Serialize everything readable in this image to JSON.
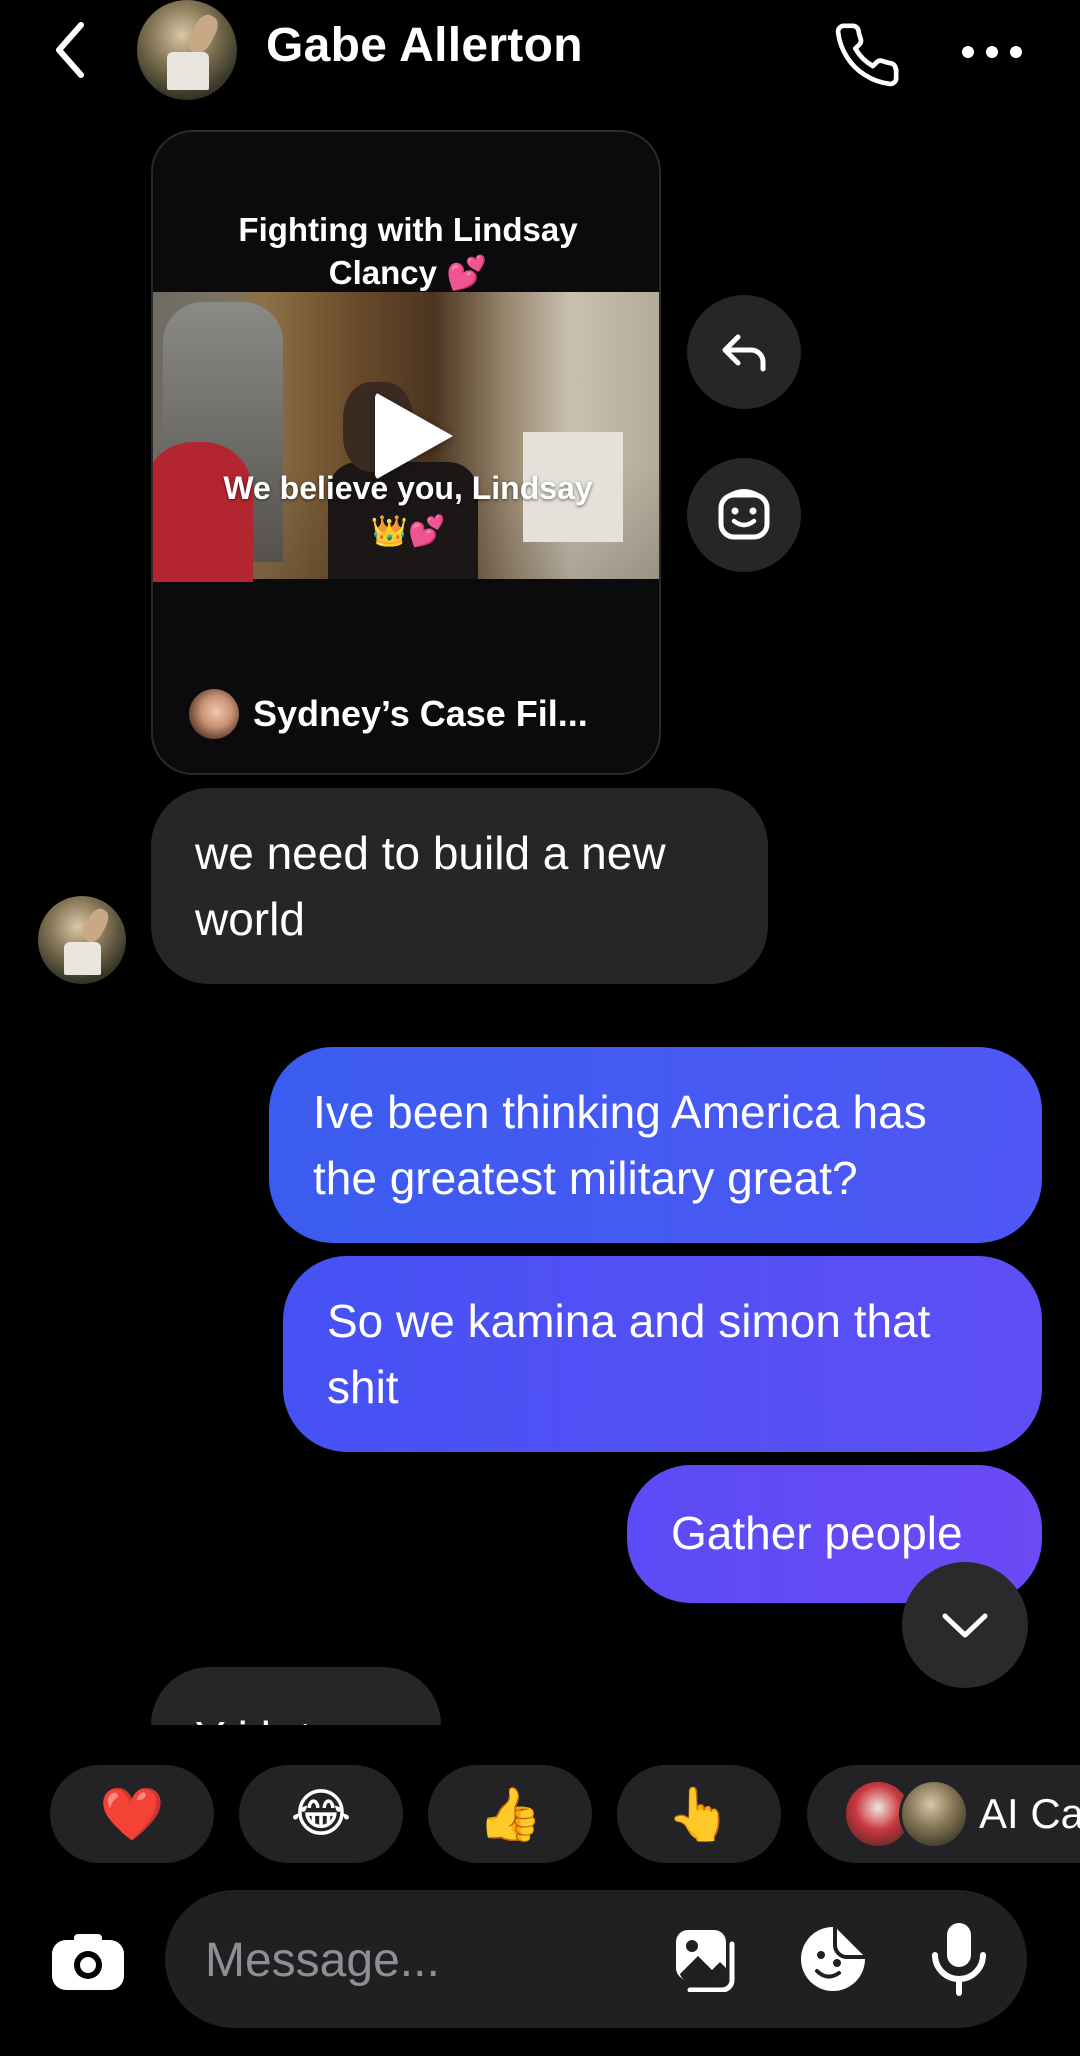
{
  "header": {
    "contact_name": "Gabe Allerton",
    "icons": [
      "back-chevron-icon",
      "phone-icon",
      "more-dots-icon"
    ]
  },
  "shared_post": {
    "caption": "Fighting with Lindsay Clancy 💕",
    "video_overlay_text": "We believe you, Lindsay",
    "video_overlay_emoji": "👑💕",
    "author_name": "Sydney’s Case Fil..."
  },
  "messages": {
    "incoming_1": "we need to build a new world",
    "outgoing_1": "Ive been thinking America has the greatest military great?",
    "outgoing_2": "So we kamina and simon that shit",
    "outgoing_3": "Gather people",
    "incoming_2_partial": "Y   i  h  t"
  },
  "reactions": {
    "items": [
      "❤️",
      "😂",
      "👍",
      "👆"
    ],
    "ai_label": "AI Ca"
  },
  "composer": {
    "placeholder": "Message..."
  },
  "colors": {
    "background": "#000000",
    "incoming_bubble": "#262628",
    "outgoing_gradient_start": "#3d5af1",
    "outgoing_gradient_end": "#6b4cf6"
  }
}
